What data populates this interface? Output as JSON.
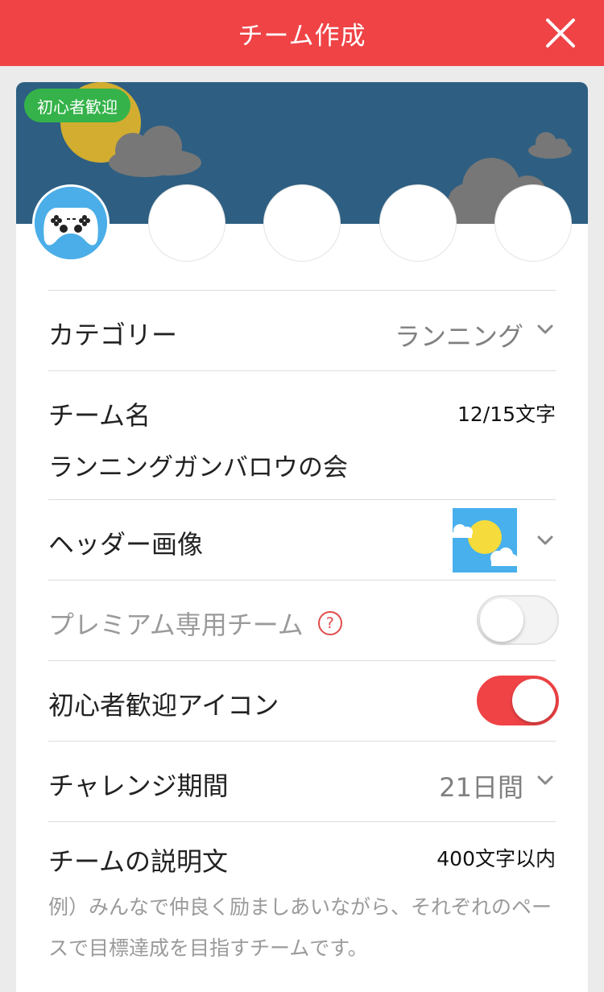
{
  "navbar": {
    "title": "チーム作成",
    "close_icon": "close-icon"
  },
  "header": {
    "badge": "初心者歓迎",
    "avatar_icon": "gamepad-icon",
    "sky_color": "#2e5f82"
  },
  "colors": {
    "accent": "#ef4346",
    "badge_green": "#35b34a",
    "avatar_blue": "#4baee8"
  },
  "category": {
    "label": "カテゴリー",
    "value": "ランニング"
  },
  "team_name": {
    "label": "チーム名",
    "count": "12/15文字",
    "value": "ランニングガンバロウの会"
  },
  "header_image": {
    "label": "ヘッダー画像",
    "thumb_icon": "sun-cloud-icon"
  },
  "premium": {
    "label": "プレミアム専用チーム",
    "help": "?",
    "enabled": false
  },
  "beginner_icon": {
    "label": "初心者歓迎アイコン",
    "enabled": true
  },
  "period": {
    "label": "チャレンジ期間",
    "value": "21日間"
  },
  "description": {
    "label": "チームの説明文",
    "count": "400文字以内",
    "placeholder": "例）みんなで仲良く励ましあいながら、それぞれのペースで目標達成を目指すチームです。"
  }
}
